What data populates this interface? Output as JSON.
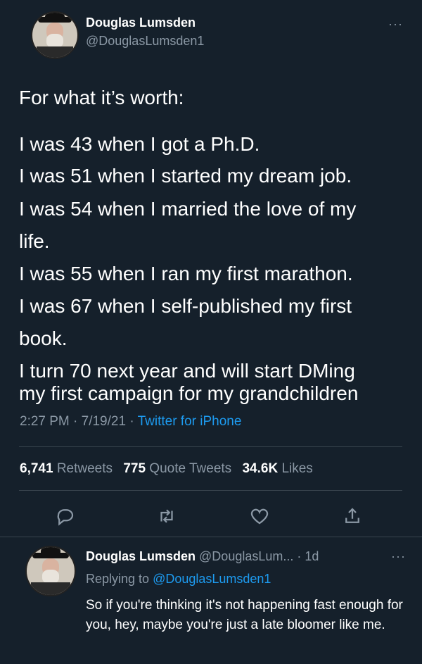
{
  "author": {
    "name": "Douglas Lumsden",
    "handle": "@DouglasLumsden1"
  },
  "tweet": {
    "lines": [
      "For what it’s worth:",
      "I was 43 when I got a Ph.D.",
      "I was 51 when I started my dream job.",
      "I was 54 when I married the love of my",
      "life.",
      "I was 55 when I ran my first marathon.",
      "I was 67 when I self-published my first",
      "book.",
      "I turn 70 next year and will start DMing",
      "my first campaign for my grandchildren"
    ],
    "time": "2:27 PM · 7/19/21 · ",
    "source": "Twitter for iPhone"
  },
  "stats": {
    "retweets_count": "6,741",
    "retweets_label": "Retweets",
    "quotes_count": "775",
    "quotes_label": "Quote Tweets",
    "likes_count": "34.6K",
    "likes_label": "Likes"
  },
  "icons": {
    "reply": "reply-icon",
    "retweet": "retweet-icon",
    "like": "heart-icon",
    "share": "share-icon",
    "more": "more-icon"
  },
  "reply": {
    "name": "Douglas Lumsden",
    "handle_time": "@DouglasLum... · 1d",
    "replying_prefix": "Replying to ",
    "replying_to": "@DouglasLumsden1",
    "text": "So if you're thinking it's not happening fast enough for you, hey, maybe you're just a late bloomer like me."
  },
  "colors": {
    "background": "#15202b",
    "accent": "#1d9bf0",
    "muted": "#8b98a5"
  }
}
